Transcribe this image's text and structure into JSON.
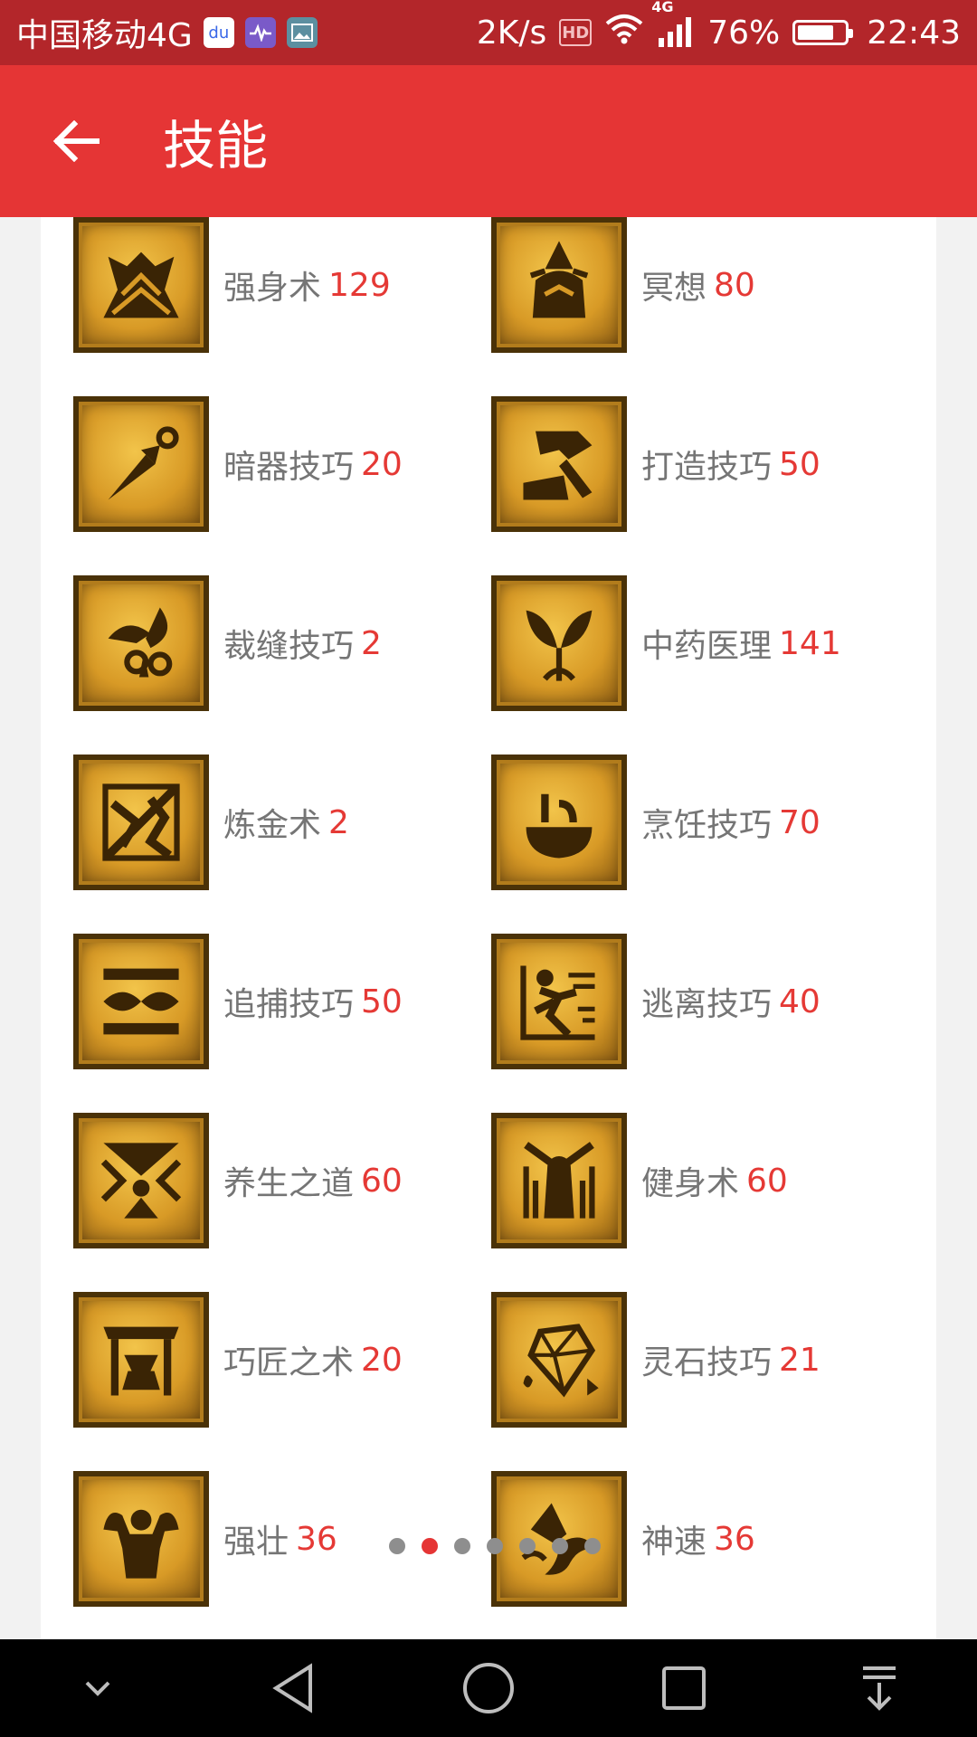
{
  "status_bar": {
    "carrier": "中国移动4G",
    "net_speed": "2K/s",
    "hd": "HD",
    "signal_type": "4G",
    "battery": "76%",
    "time": "22:43"
  },
  "app_bar": {
    "title": "技能"
  },
  "skills": [
    {
      "name": "强身术",
      "level": "129"
    },
    {
      "name": "冥想",
      "level": "80"
    },
    {
      "name": "暗器技巧",
      "level": "20"
    },
    {
      "name": "打造技巧",
      "level": "50"
    },
    {
      "name": "裁缝技巧",
      "level": "2"
    },
    {
      "name": "中药医理",
      "level": "141"
    },
    {
      "name": "炼金术",
      "level": "2"
    },
    {
      "name": "烹饪技巧",
      "level": "70"
    },
    {
      "name": "追捕技巧",
      "level": "50"
    },
    {
      "name": "逃离技巧",
      "level": "40"
    },
    {
      "name": "养生之道",
      "level": "60"
    },
    {
      "name": "健身术",
      "level": "60"
    },
    {
      "name": "巧匠之术",
      "level": "20"
    },
    {
      "name": "灵石技巧",
      "level": "21"
    },
    {
      "name": "强壮",
      "level": "36"
    },
    {
      "name": "神速",
      "level": "36"
    }
  ],
  "pager": {
    "total_pages": 7,
    "active_page": 2
  },
  "colors": {
    "status_bar": "#b3262a",
    "app_bar": "#e53535",
    "level_text": "#e53935",
    "name_text": "#757575"
  }
}
